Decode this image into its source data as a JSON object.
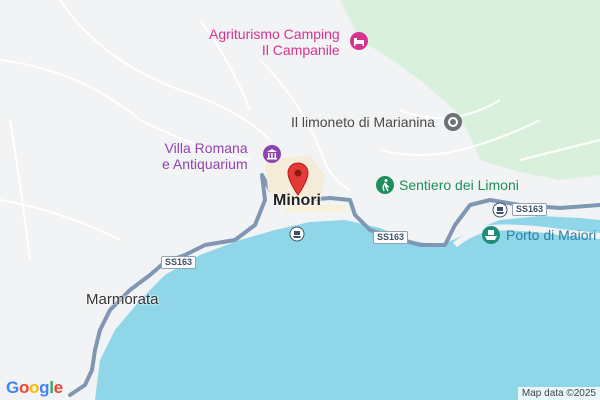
{
  "labels": {
    "agriturismo_line1": "Agriturismo Camping",
    "agriturismo_line2": "Il Campanile",
    "villa_line1": "Villa Romana",
    "villa_line2": "e Antiquarium",
    "limoneto": "Il limoneto di Marianina",
    "sentiero": "Sentiero dei Limoni",
    "minori": "Minori",
    "porto": "Porto di Maiori",
    "marmorata": "Marmorata"
  },
  "roads": {
    "ss163_a": "SS163",
    "ss163_b": "SS163",
    "ss163_c": "SS163"
  },
  "branding": {
    "google": [
      "G",
      "o",
      "o",
      "g",
      "l",
      "e"
    ],
    "google_colors": [
      "#4285F4",
      "#EA4335",
      "#FBBC05",
      "#4285F4",
      "#34A853",
      "#EA4335"
    ],
    "attribution": "Map data ©2025"
  },
  "colors": {
    "sea": "#8fd6e8",
    "land": "#f1f3f4",
    "park": "#d9f0dc",
    "road": "#7f97b3",
    "marker": "#e53935"
  },
  "icons": {
    "agriturismo": "bed-icon",
    "villa": "museum-icon",
    "limoneto": "place-icon",
    "sentiero": "hiking-icon",
    "porto": "ferry-icon"
  }
}
